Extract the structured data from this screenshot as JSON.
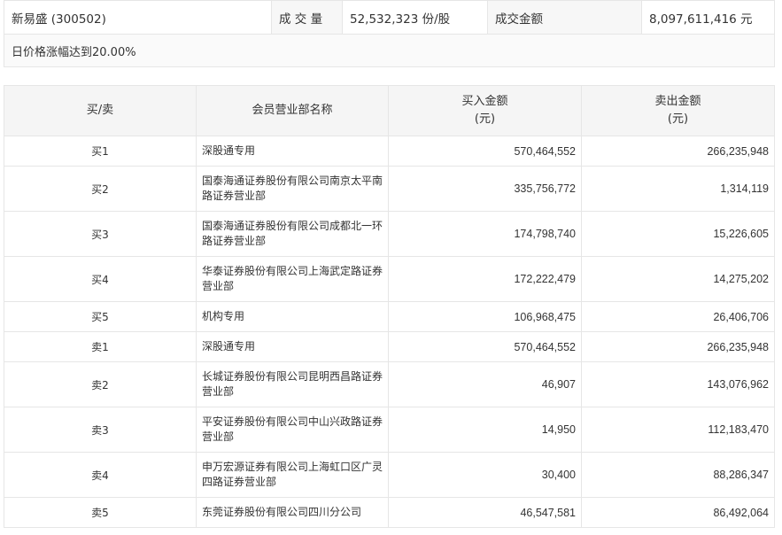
{
  "summary": {
    "stock_name": "新易盛 (300502)",
    "volume_label": "成 交 量",
    "volume_value": "52,532,323 份/股",
    "amount_label": "成交金额",
    "amount_value": "8,097,611,416 元",
    "note": "日价格涨幅达到20.00%"
  },
  "traders": {
    "headers": {
      "side": "买/卖",
      "name": "会员营业部名称",
      "buy": "买入金额",
      "buy_unit": "(元)",
      "sell": "卖出金额",
      "sell_unit": "(元)"
    },
    "rows": [
      {
        "side": "买1",
        "name": "深股通专用",
        "buy": "570,464,552",
        "sell": "266,235,948"
      },
      {
        "side": "买2",
        "name": "国泰海通证券股份有限公司南京太平南路证券营业部",
        "buy": "335,756,772",
        "sell": "1,314,119"
      },
      {
        "side": "买3",
        "name": "国泰海通证券股份有限公司成都北一环路证券营业部",
        "buy": "174,798,740",
        "sell": "15,226,605"
      },
      {
        "side": "买4",
        "name": "华泰证券股份有限公司上海武定路证券营业部",
        "buy": "172,222,479",
        "sell": "14,275,202"
      },
      {
        "side": "买5",
        "name": "机构专用",
        "buy": "106,968,475",
        "sell": "26,406,706"
      },
      {
        "side": "卖1",
        "name": "深股通专用",
        "buy": "570,464,552",
        "sell": "266,235,948"
      },
      {
        "side": "卖2",
        "name": "长城证券股份有限公司昆明西昌路证券营业部",
        "buy": "46,907",
        "sell": "143,076,962"
      },
      {
        "side": "卖3",
        "name": "平安证券股份有限公司中山兴政路证券营业部",
        "buy": "14,950",
        "sell": "112,183,470"
      },
      {
        "side": "卖4",
        "name": "申万宏源证券有限公司上海虹口区广灵四路证券营业部",
        "buy": "30,400",
        "sell": "88,286,347"
      },
      {
        "side": "卖5",
        "name": "东莞证券股份有限公司四川分公司",
        "buy": "46,547,581",
        "sell": "86,492,064"
      }
    ]
  }
}
